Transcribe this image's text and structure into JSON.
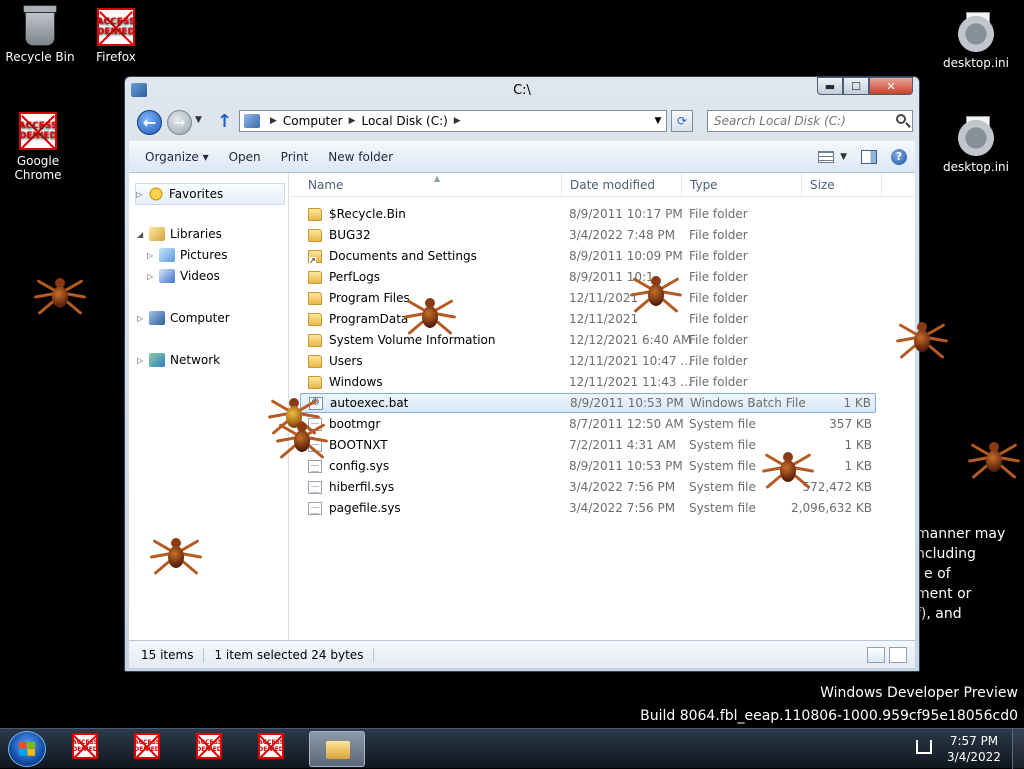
{
  "desktop": {
    "icons": [
      {
        "label": "Recycle Bin"
      },
      {
        "label": "Firefox",
        "badge": "ACCESS DENIED"
      },
      {
        "label": "Google Chrome",
        "badge": "ACCESS DENIED"
      },
      {
        "label": "desktop.ini"
      },
      {
        "label": "desktop.ini"
      }
    ],
    "side_text": [
      "manner may",
      "ncluding",
      "e of",
      "ment or",
      "f), and"
    ],
    "watermark": {
      "line1": "Windows Developer Preview",
      "line2": "Build 8064.fbl_eeap.110806-1000.959cf95e18056cd0"
    }
  },
  "window": {
    "title": "C:\\",
    "caption": {
      "minimize": "▬",
      "maximize": "☐",
      "close": "✕"
    },
    "address": [
      "Computer",
      "Local Disk (C:)"
    ],
    "search_placeholder": "Search Local Disk (C:)",
    "commands": {
      "organize": "Organize ▾",
      "open": "Open",
      "print": "Print",
      "new_folder": "New folder"
    },
    "nav_pane": {
      "favorites": "Favorites",
      "libraries": "Libraries",
      "pictures": "Pictures",
      "videos": "Videos",
      "computer": "Computer",
      "network": "Network"
    },
    "columns": {
      "name": "Name",
      "date": "Date modified",
      "type": "Type",
      "size": "Size"
    },
    "files": [
      {
        "name": "$Recycle.Bin",
        "date": "8/9/2011 10:17 PM",
        "type": "File folder",
        "size": ""
      },
      {
        "name": "BUG32",
        "date": "3/4/2022 7:48 PM",
        "type": "File folder",
        "size": ""
      },
      {
        "name": "Documents and Settings",
        "date": "8/9/2011 10:09 PM",
        "type": "File folder",
        "size": ""
      },
      {
        "name": "PerfLogs",
        "date": "8/9/2011 10:1",
        "type": "File folder",
        "size": ""
      },
      {
        "name": "Program Files",
        "date": "12/11/2021",
        "type": "File folder",
        "size": ""
      },
      {
        "name": "ProgramData",
        "date": "12/11/2021",
        "type": "File folder",
        "size": ""
      },
      {
        "name": "System Volume Information",
        "date": "12/12/2021 6:40 AM",
        "type": "File folder",
        "size": ""
      },
      {
        "name": "Users",
        "date": "12/11/2021 10:47 ...",
        "type": "File folder",
        "size": ""
      },
      {
        "name": "Windows",
        "date": "12/11/2021 11:43 ...",
        "type": "File folder",
        "size": ""
      },
      {
        "name": "autoexec.bat",
        "date": "8/9/2011 10:53 PM",
        "type": "Windows Batch File",
        "size": "1 KB"
      },
      {
        "name": "bootmgr",
        "date": "8/7/2011 12:50 AM",
        "type": "System file",
        "size": "357 KB"
      },
      {
        "name": "BOOTNXT",
        "date": "7/2/2011 4:31 AM",
        "type": "System file",
        "size": "1 KB"
      },
      {
        "name": "config.sys",
        "date": "8/9/2011 10:53 PM",
        "type": "System file",
        "size": "1 KB"
      },
      {
        "name": "hiberfil.sys",
        "date": "3/4/2022 7:56 PM",
        "type": "System file",
        "size": "572,472 KB"
      },
      {
        "name": "pagefile.sys",
        "date": "3/4/2022 7:56 PM",
        "type": "System file",
        "size": "2,096,632 KB"
      }
    ],
    "status": {
      "items": "15 items",
      "selection": "1 item selected  24 bytes"
    }
  },
  "taskbar": {
    "pinned_badge": "ACCESS DENIED",
    "time": "7:57 PM",
    "date": "3/4/2022"
  },
  "colors": {
    "accent": "#1d57b5",
    "selection": "#d8e8f9",
    "denied": "#dd0000"
  }
}
